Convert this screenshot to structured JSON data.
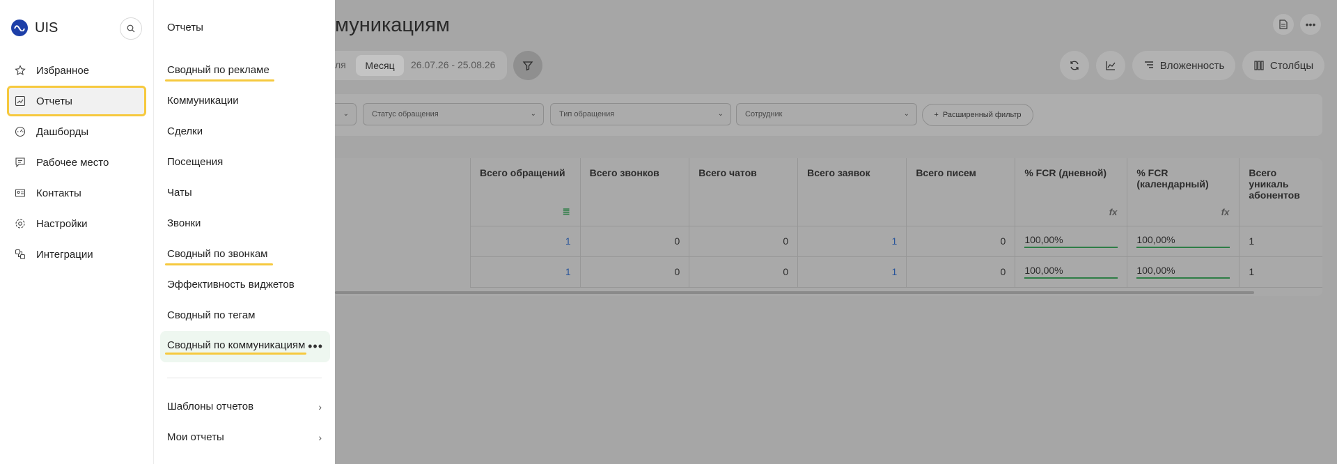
{
  "sidebar": {
    "brand": "UIS",
    "items": [
      {
        "label": "Избранное",
        "icon": "star-icon"
      },
      {
        "label": "Отчеты",
        "icon": "report-icon"
      },
      {
        "label": "Дашборды",
        "icon": "dashboard-icon"
      },
      {
        "label": "Рабочее место",
        "icon": "workplace-icon"
      },
      {
        "label": "Контакты",
        "icon": "contacts-icon"
      },
      {
        "label": "Настройки",
        "icon": "gear-icon"
      },
      {
        "label": "Интеграции",
        "icon": "integrations-icon"
      }
    ]
  },
  "submenu": {
    "title": "Отчеты",
    "items": [
      "Сводный по рекламе",
      "Коммуникации",
      "Сделки",
      "Посещения",
      "Чаты",
      "Звонки",
      "Сводный по звонкам",
      "Эффективность виджетов",
      "Сводный по тегам",
      "Сводный по коммуникациям"
    ],
    "templates": "Шаблоны отчетов",
    "my_reports": "Мои отчеты"
  },
  "main": {
    "title": "муникациям",
    "period_prev": "ля",
    "period_month": "Месяц",
    "date_range": "26.07.26 - 25.08.26",
    "toolbar": {
      "nesting": "Вложенность",
      "columns": "Столбцы"
    },
    "filters": {
      "status": "Статус обращения",
      "type": "Тип обращения",
      "employee": "Сотрудник",
      "advanced": "Расширенный фильтр"
    },
    "table": {
      "headers": [
        "Всего обращений",
        "Всего звонков",
        "Всего чатов",
        "Всего заявок",
        "Всего писем",
        "% FCR (дневной)",
        "% FCR (календарный)",
        "Всего уникаль абонентов"
      ],
      "rows": [
        [
          "1",
          "0",
          "0",
          "1",
          "0",
          "100,00%",
          "100,00%",
          "1"
        ],
        [
          "1",
          "0",
          "0",
          "1",
          "0",
          "100,00%",
          "100,00%",
          "1"
        ]
      ]
    }
  },
  "colors": {
    "highlight": "#f6c93e",
    "brand": "#1d3fa8",
    "active_bg": "#eef7f0"
  }
}
